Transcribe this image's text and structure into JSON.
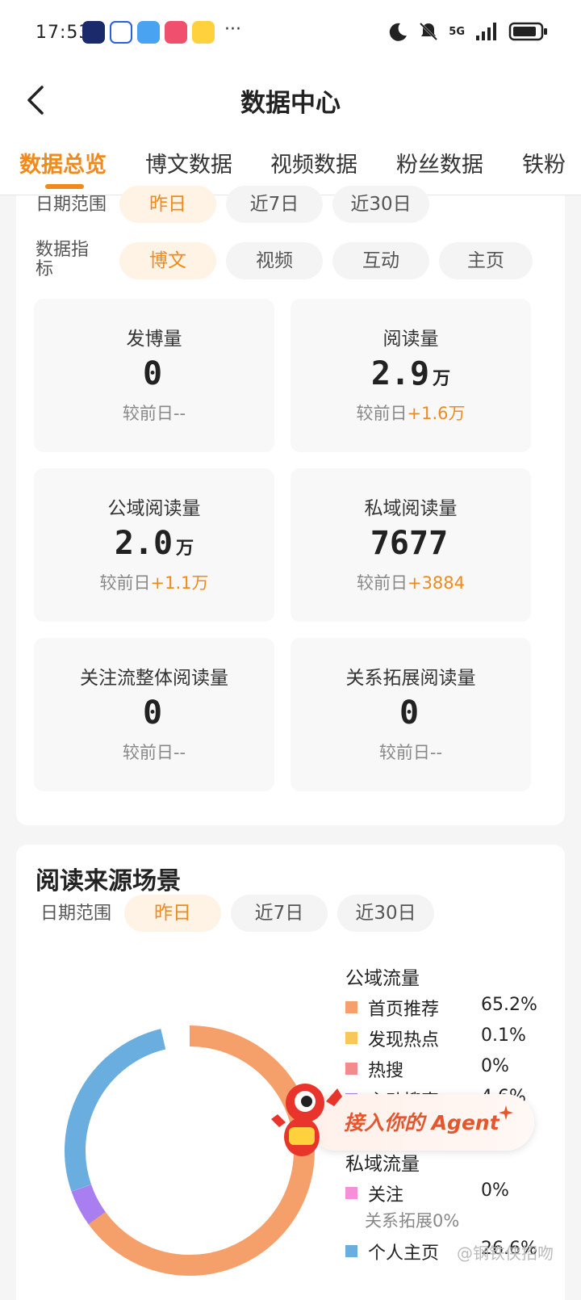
{
  "status_bar": {
    "time": "17:53",
    "dots": "···",
    "network": "5G"
  },
  "header": {
    "title": "数据中心"
  },
  "tabs": [
    "数据总览",
    "博文数据",
    "视频数据",
    "粉丝数据",
    "铁粉"
  ],
  "overview": {
    "date_label": "日期范围",
    "date_options": [
      "昨日",
      "近7日",
      "近30日"
    ],
    "metric_label": "数据指标",
    "metric_options": [
      "博文",
      "视频",
      "互动",
      "主页"
    ],
    "stats": [
      {
        "label": "发博量",
        "value": "0",
        "unit": "",
        "cmp_prefix": "较前日",
        "cmp_value": "--",
        "cmp_up": false
      },
      {
        "label": "阅读量",
        "value": "2.9",
        "unit": "万",
        "cmp_prefix": "较前日",
        "cmp_value": "+1.6万",
        "cmp_up": true
      },
      {
        "label": "公域阅读量",
        "value": "2.0",
        "unit": "万",
        "cmp_prefix": "较前日",
        "cmp_value": "+1.1万",
        "cmp_up": true
      },
      {
        "label": "私域阅读量",
        "value": "7677",
        "unit": "",
        "cmp_prefix": "较前日",
        "cmp_value": "+3884",
        "cmp_up": true
      },
      {
        "label": "关注流整体阅读量",
        "value": "0",
        "unit": "",
        "cmp_prefix": "较前日",
        "cmp_value": "--",
        "cmp_up": false
      },
      {
        "label": "关系拓展阅读量",
        "value": "0",
        "unit": "",
        "cmp_prefix": "较前日",
        "cmp_value": "--",
        "cmp_up": false
      }
    ]
  },
  "source": {
    "title": "阅读来源场景",
    "date_label": "日期范围",
    "date_options": [
      "昨日",
      "近7日",
      "近30日"
    ],
    "public_title": "公域流量",
    "public_items": [
      {
        "name": "首页推荐",
        "value": "65.2%",
        "color": "#f5a06a"
      },
      {
        "name": "发现热点",
        "value": "0.1%",
        "color": "#f7c75a"
      },
      {
        "name": "热搜",
        "value": "0%",
        "color": "#f28b8b"
      },
      {
        "name": "主动搜索",
        "value": "4.6%",
        "color": "#a97ef0"
      }
    ],
    "private_title": "私域流量",
    "private_items": [
      {
        "name": "关注",
        "value": "0%",
        "color": "#f48fd8"
      },
      {
        "name": "个人主页",
        "value": "26.6%",
        "color": "#6aaee0"
      }
    ],
    "sub_note": "关系拓展0%"
  },
  "banner": {
    "text": "接入你的 Agent"
  },
  "watermark": "@钢铁侠招吻"
}
